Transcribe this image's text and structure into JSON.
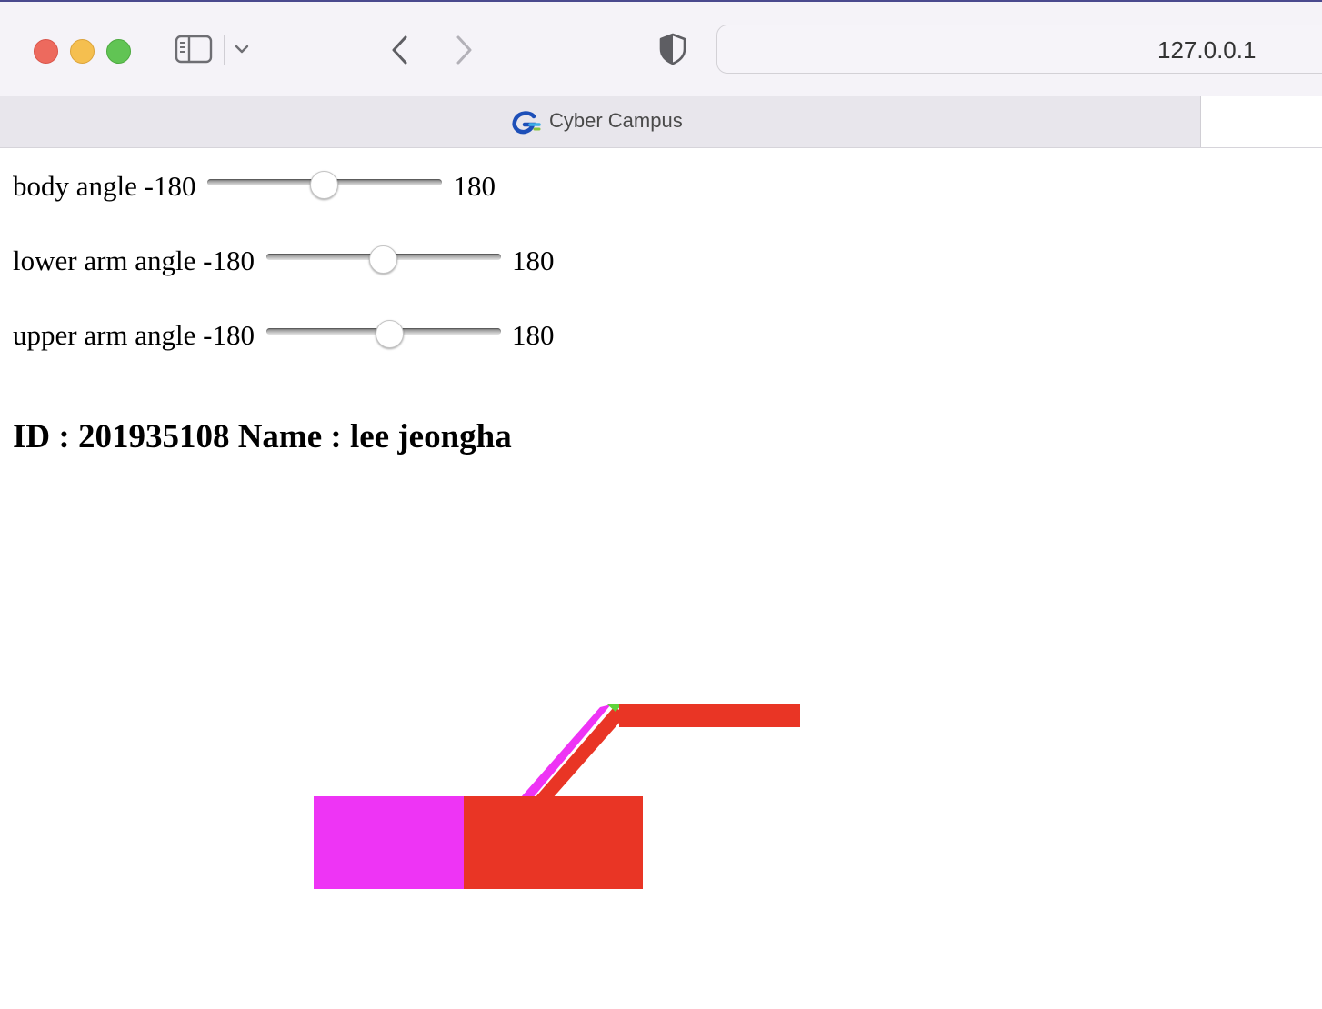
{
  "browser": {
    "url": "127.0.0.1",
    "tab_title": "Cyber Campus",
    "icons": [
      "sidebar-icon",
      "chevron-down-icon",
      "back-icon",
      "forward-icon",
      "shield-icon",
      "favicon-icon"
    ]
  },
  "controls": {
    "body": {
      "label": "body angle -180",
      "max_label": "180",
      "min": -180,
      "max": 180,
      "value": 0
    },
    "lower_arm": {
      "label": "lower arm angle -180",
      "max_label": "180",
      "min": -180,
      "max": 180,
      "value": 0
    },
    "upper_arm": {
      "label": "upper arm angle -180",
      "max_label": "180",
      "min": -180,
      "max": 180,
      "value": 10
    }
  },
  "heading": "ID : 201935108 Name : lee jeongha",
  "colors": {
    "magenta": "#ee34f5",
    "red": "#e93525",
    "green": "#5fd33a",
    "traffic_red": "#ed6a5e",
    "traffic_yellow": "#f5bf4f",
    "traffic_green": "#61c454"
  }
}
